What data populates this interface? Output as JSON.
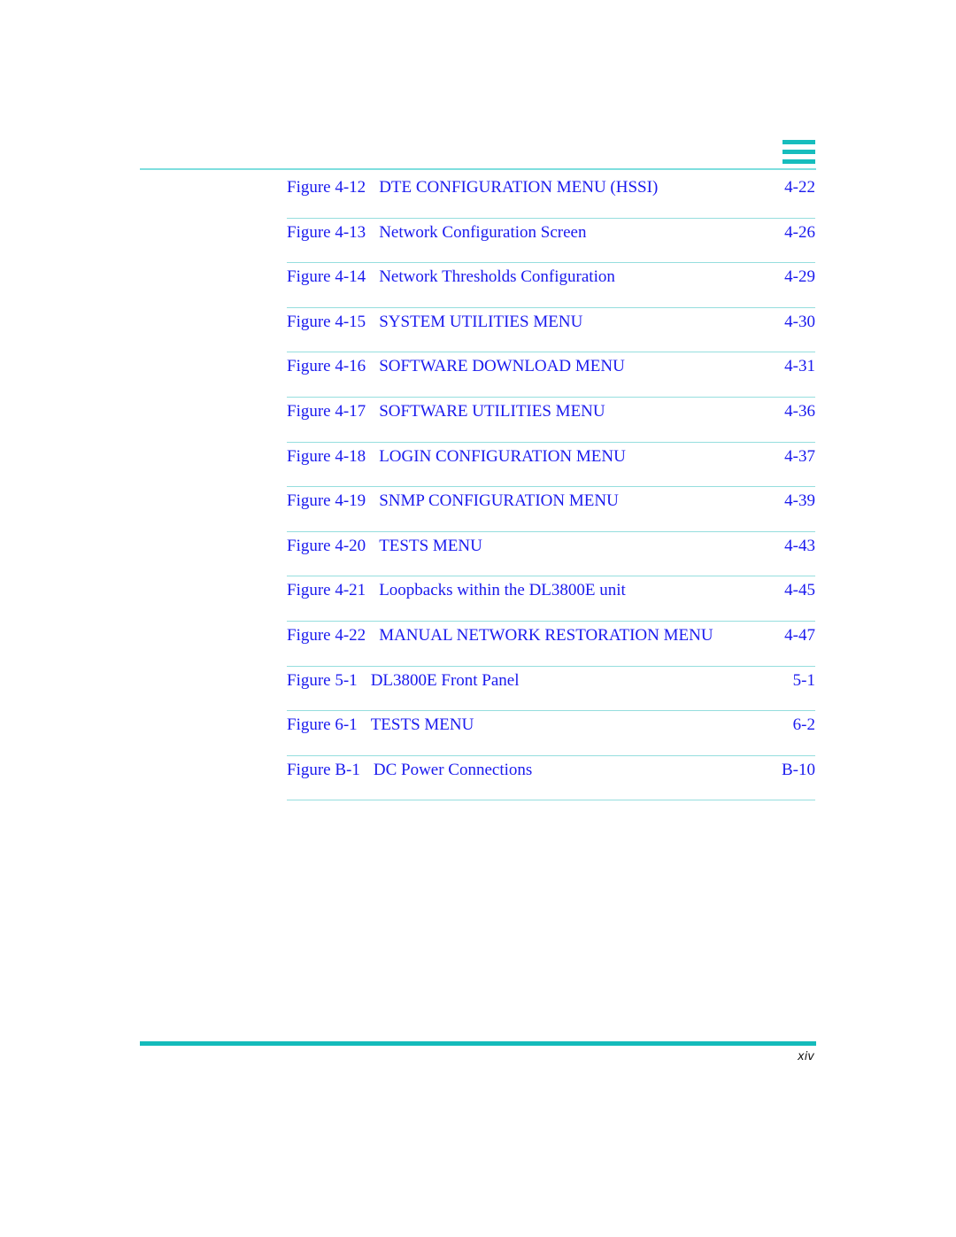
{
  "header": {
    "menu_icon": "hamburger-menu-icon"
  },
  "entries": [
    {
      "figure": "Figure 4-12",
      "title": "DTE CONFIGURATION MENU (HSSI)",
      "page": "4-22"
    },
    {
      "figure": "Figure 4-13",
      "title": "Network Configuration Screen",
      "page": "4-26"
    },
    {
      "figure": "Figure 4-14",
      "title": "Network Thresholds Configuration",
      "page": "4-29"
    },
    {
      "figure": "Figure 4-15",
      "title": "SYSTEM UTILITIES MENU",
      "page": "4-30"
    },
    {
      "figure": "Figure 4-16",
      "title": "SOFTWARE DOWNLOAD MENU",
      "page": "4-31"
    },
    {
      "figure": "Figure 4-17",
      "title": "SOFTWARE UTILITIES MENU",
      "page": "4-36"
    },
    {
      "figure": "Figure 4-18",
      "title": "LOGIN CONFIGURATION MENU",
      "page": "4-37"
    },
    {
      "figure": "Figure 4-19",
      "title": "SNMP CONFIGURATION MENU",
      "page": "4-39"
    },
    {
      "figure": "Figure 4-20",
      "title": "TESTS MENU",
      "page": "4-43"
    },
    {
      "figure": "Figure 4-21",
      "title": "Loopbacks within the DL3800E unit",
      "page": "4-45"
    },
    {
      "figure": "Figure 4-22",
      "title": "MANUAL NETWORK RESTORATION MENU",
      "page": "4-47"
    },
    {
      "figure": "Figure 5-1",
      "title": "DL3800E Front Panel",
      "page": "5-1"
    },
    {
      "figure": "Figure 6-1",
      "title": "TESTS MENU",
      "page": "6-2"
    },
    {
      "figure": "Figure B-1",
      "title": "DC Power Connections",
      "page": "B-10"
    }
  ],
  "footer": {
    "page_number": "xiv"
  },
  "colors": {
    "link": "#1a1aee",
    "accent": "#14bbbb",
    "rule": "#96dede"
  }
}
